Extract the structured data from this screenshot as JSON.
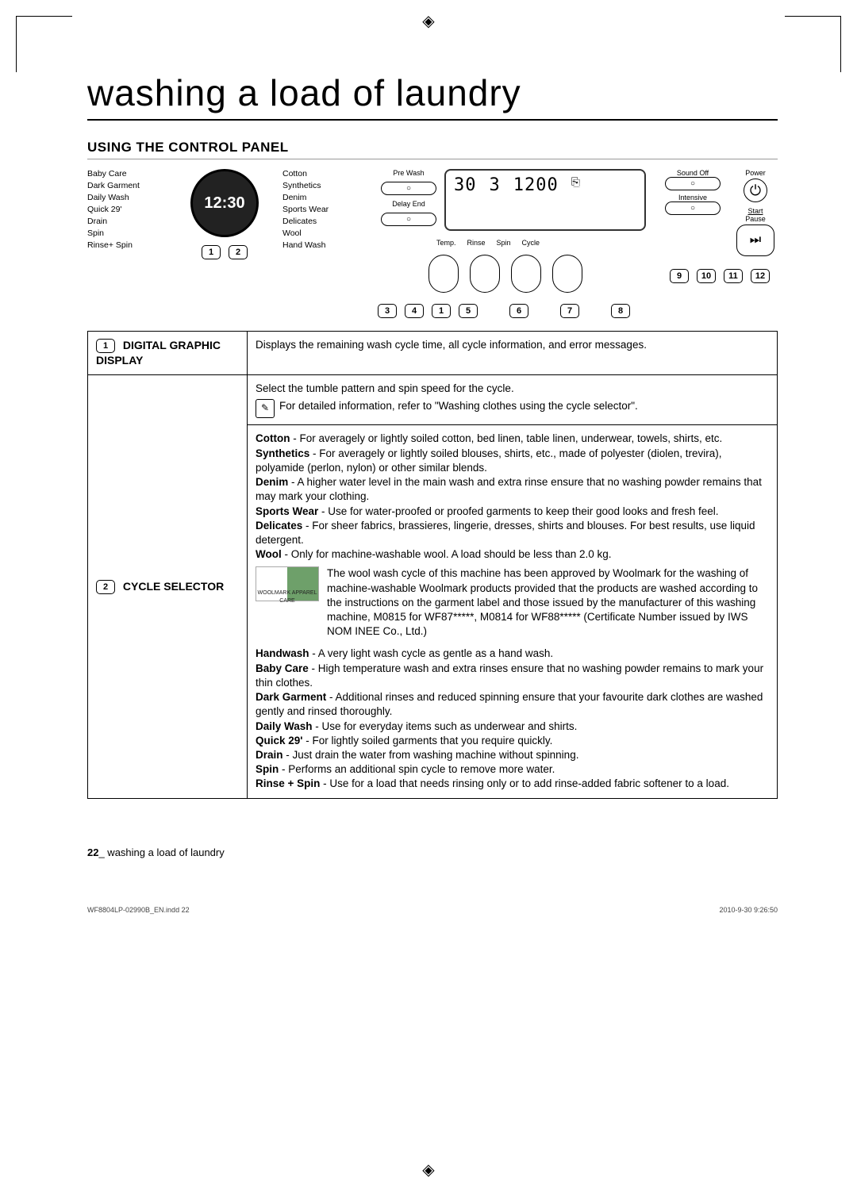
{
  "title": "washing a load of laundry",
  "section_heading": "USING THE CONTROL PANEL",
  "panel": {
    "left_cycles": [
      "Baby Care",
      "Dark Garment",
      "Daily Wash",
      "Quick 29'",
      "Drain",
      "Spin",
      "Rinse+ Spin"
    ],
    "right_cycles": [
      "Cotton",
      "Synthetics",
      "Denim",
      "Sports Wear",
      "Delicates",
      "Wool",
      "Hand Wash"
    ],
    "dial_time": "12:30",
    "pre_wash": "Pre Wash",
    "delay_end": "Delay End",
    "temp_value": "30",
    "rinse_value": "3",
    "spin_value": "1200",
    "temp_label": "Temp.",
    "rinse_label": "Rinse",
    "spin_label": "Spin",
    "cycle_label": "Cycle",
    "sound_off": "Sound Off",
    "intensive": "Intensive",
    "power": "Power",
    "start": "Start",
    "pause": "Pause",
    "callout_numbers": [
      "1",
      "2",
      "3",
      "4",
      "1",
      "5",
      "6",
      "7",
      "8",
      "9",
      "10",
      "11",
      "12"
    ]
  },
  "table": {
    "row1": {
      "num": "1",
      "label": "DIGITAL GRAPHIC DISPLAY",
      "text": "Displays the remaining wash cycle time, all cycle information, and error messages."
    },
    "row2": {
      "num": "2",
      "label": "CYCLE SELECTOR",
      "intro": "Select the tumble pattern and spin speed for the cycle.",
      "refer": "For detailed information, refer to \"Washing clothes using the cycle selector\".",
      "cotton_l": "Cotton",
      "cotton": " - For averagely or lightly soiled cotton, bed linen, table linen, underwear, towels, shirts, etc.",
      "synth_l": "Synthetics",
      "synth": " - For averagely or lightly soiled blouses, shirts, etc., made of polyester (diolen, trevira), polyamide (perlon, nylon) or other similar blends.",
      "denim_l": "Denim",
      "denim": " - A higher water level in the main wash and extra rinse ensure that no washing powder remains that may mark your clothing.",
      "sports_l": "Sports Wear",
      "sports": " - Use for water-proofed or proofed garments to keep their good looks and fresh feel.",
      "delic_l": "Delicates",
      "delic": " - For sheer fabrics, brassieres, lingerie, dresses, shirts and blouses. For best results, use liquid detergent.",
      "wool_l": "Wool",
      "wool": " - Only for machine-washable wool. A load should be less than 2.0 kg.",
      "woolmark": "The wool wash cycle of this machine has been approved by Woolmark for the washing of machine-washable Woolmark products provided that the products are washed according to the instructions on the garment label and those issued by the manufacturer of this washing machine, M0815 for WF87*****, M0814 for WF88***** (Certificate Number issued by IWS NOM INEE Co., Ltd.)",
      "woolmark_badge": "WOOLMARK APPAREL CARE",
      "hand_l": "Handwash",
      "hand": " - A very light wash cycle as gentle as a hand wash.",
      "baby_l": "Baby Care",
      "baby": " - High temperature wash and extra rinses ensure that no washing powder remains to mark your thin clothes.",
      "dark_l": "Dark Garment",
      "dark": " - Additional rinses and reduced spinning ensure that your favourite dark clothes are washed gently and rinsed thoroughly.",
      "daily_l": "Daily Wash",
      "daily": " - Use for everyday items such as underwear and shirts.",
      "quick_l": "Quick 29'",
      "quick": " - For lightly soiled garments that you require quickly.",
      "drain_l": "Drain",
      "drain": " - Just drain the water from washing machine without spinning.",
      "spin_l": "Spin",
      "spin": " - Performs an additional spin cycle to remove more water.",
      "rinsespin_l": "Rinse + Spin",
      "rinsespin": " - Use for a load that needs rinsing only or to add rinse-added fabric softener to a load."
    }
  },
  "footer": {
    "page_num": "22",
    "page_label": "_ washing a load of laundry",
    "file": "WF8804LP-02990B_EN.indd   22",
    "timestamp": "2010-9-30   9:26:50"
  }
}
